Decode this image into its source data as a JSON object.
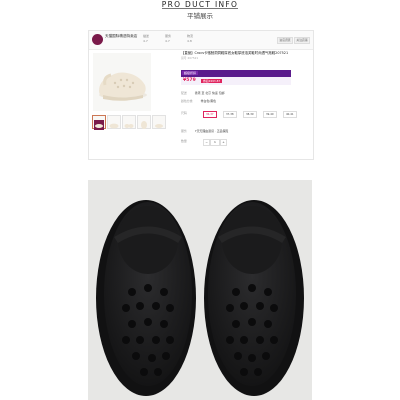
{
  "header": {
    "title": "PRO DUCT INFO",
    "subtitle": "平铺展示"
  },
  "shop": {
    "name": "天猫国际精选特卖店",
    "stats": [
      {
        "label": "描述",
        "value": "4.7"
      },
      {
        "label": "服务",
        "value": "4.7"
      },
      {
        "label": "物流",
        "value": "4.8"
      }
    ],
    "buttons": [
      "进店逛逛",
      "关注店铺"
    ],
    "logo_color": "#7a1a4a"
  },
  "product": {
    "title": "【直营】Crocs卡骆驰洞洞鞋厚底女鞋厚底泡芙鞋时尚透气拖鞋207521",
    "code": "货号 207521",
    "promo_label": "超级折扣",
    "price": "¥579",
    "coupon": "券后¥493.87",
    "labels": {
      "delivery": "配送",
      "color": "颜色分类",
      "size": "尺码",
      "service": "服务",
      "quantity": "数量"
    },
    "delivery_value": "香港 至 北京  快递 包邮",
    "color_value": "骨白色/黑色",
    "sizes": [
      "36-37",
      "37-38",
      "38-39",
      "39-40",
      "40-41"
    ],
    "selected_size": "36-37",
    "service_value": "7天无理由退货 · 正品保障",
    "quantity": "1",
    "accent_color": "#5a1b8c",
    "price_color": "#e0245e"
  },
  "photo": {
    "shoe_color": "#1f1f20",
    "background": "#e7e7e5"
  }
}
